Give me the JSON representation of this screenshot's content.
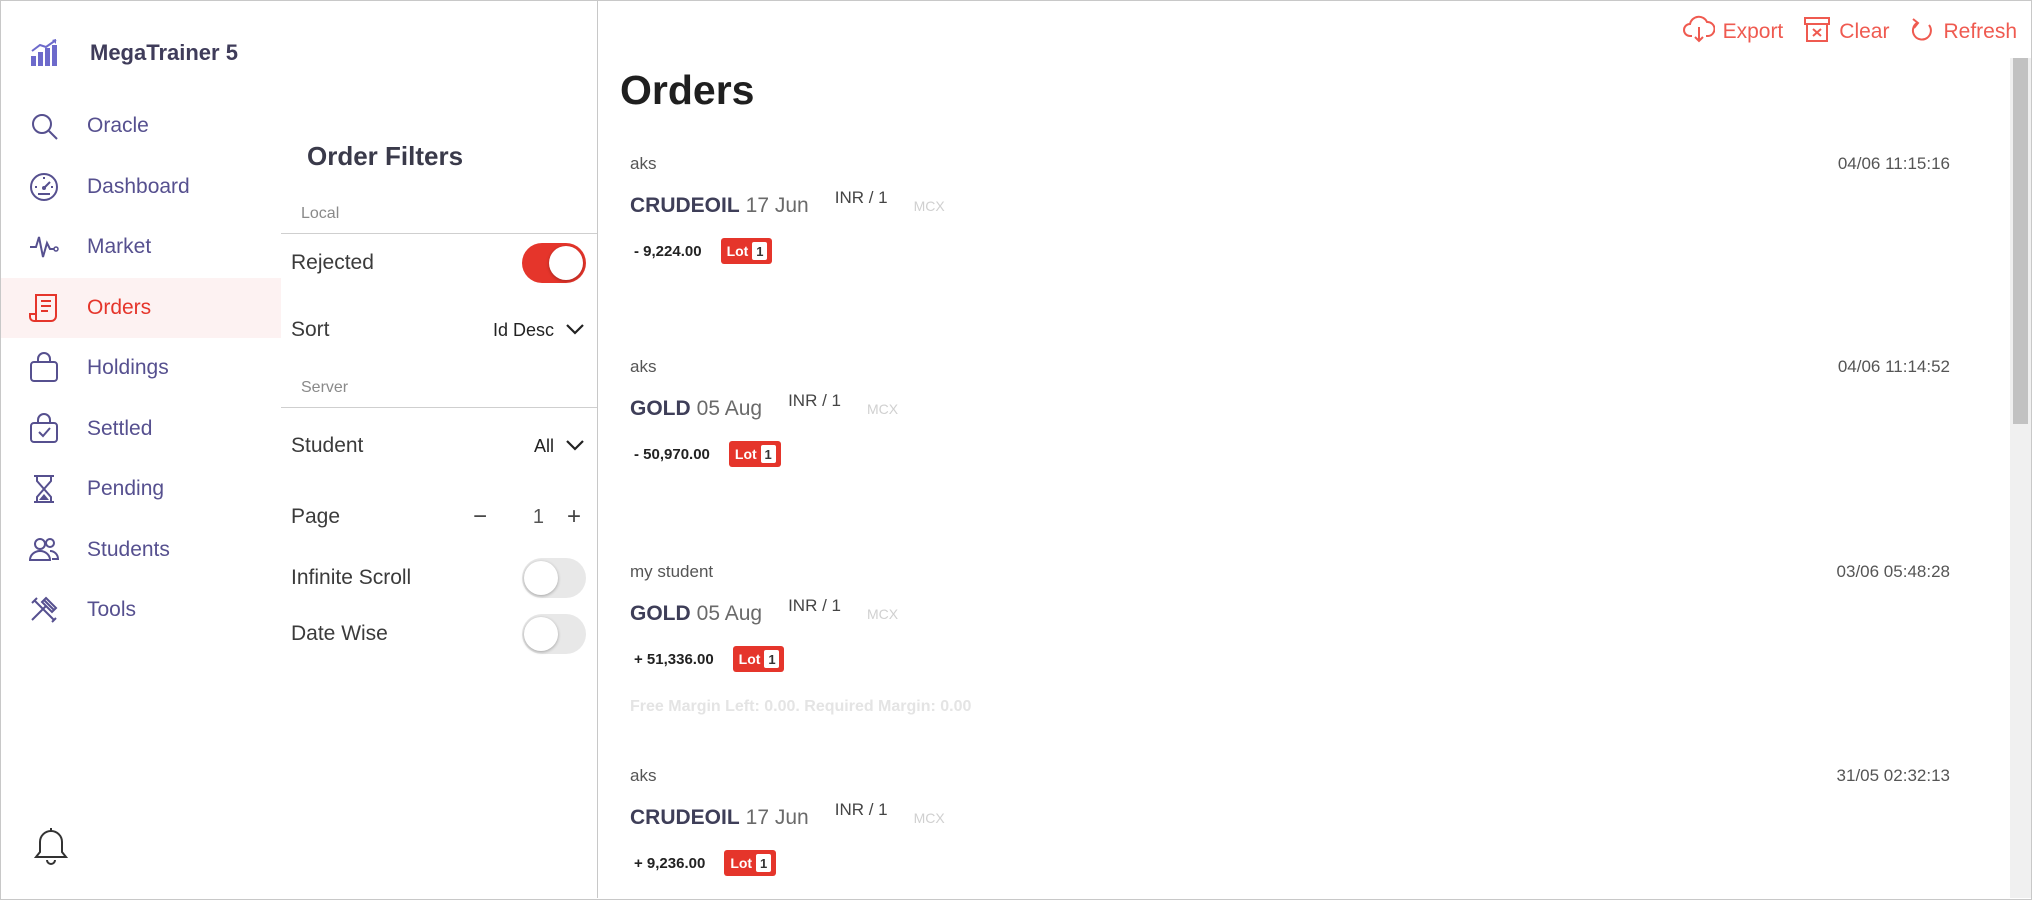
{
  "app": {
    "name": "MegaTrainer 5"
  },
  "nav": {
    "items": [
      {
        "label": "Oracle",
        "icon": "search-icon"
      },
      {
        "label": "Dashboard",
        "icon": "gauge-icon"
      },
      {
        "label": "Market",
        "icon": "pulse-icon"
      },
      {
        "label": "Orders",
        "icon": "receipt-icon",
        "active": true
      },
      {
        "label": "Holdings",
        "icon": "bag-icon"
      },
      {
        "label": "Settled",
        "icon": "bag-check-icon"
      },
      {
        "label": "Pending",
        "icon": "hourglass-icon"
      },
      {
        "label": "Students",
        "icon": "users-icon"
      },
      {
        "label": "Tools",
        "icon": "tools-icon"
      }
    ]
  },
  "filters": {
    "title": "Order Filters",
    "local_label": "Local",
    "rejected_label": "Rejected",
    "rejected_on": true,
    "sort_label": "Sort",
    "sort_value": "Id Desc",
    "server_label": "Server",
    "student_label": "Student",
    "student_value": "All",
    "page_label": "Page",
    "page_value": "1",
    "page_minus": "−",
    "page_plus": "+",
    "infinite_label": "Infinite Scroll",
    "infinite_on": false,
    "datewise_label": "Date Wise",
    "datewise_on": false
  },
  "toolbar": {
    "export": "Export",
    "clear": "Clear",
    "refresh": "Refresh"
  },
  "main": {
    "title": "Orders"
  },
  "orders": [
    {
      "user": "aks",
      "time": "04/06 11:15:16",
      "symbol": "CRUDEOIL",
      "expiry": "17 Jun",
      "currency": "INR / 1",
      "exchange": "MCX",
      "amount": "- 9,224.00",
      "lot_label": "Lot",
      "lot": "1",
      "note": ""
    },
    {
      "user": "aks",
      "time": "04/06 11:14:52",
      "symbol": "GOLD",
      "expiry": "05 Aug",
      "currency": "INR / 1",
      "exchange": "MCX",
      "amount": "- 50,970.00",
      "lot_label": "Lot",
      "lot": "1",
      "note": ""
    },
    {
      "user": "my student",
      "time": "03/06 05:48:28",
      "symbol": "GOLD",
      "expiry": "05 Aug",
      "currency": "INR / 1",
      "exchange": "MCX",
      "amount": "+ 51,336.00",
      "lot_label": "Lot",
      "lot": "1",
      "note": "Free Margin Left: 0.00. Required Margin: 0.00"
    },
    {
      "user": "aks",
      "time": "31/05 02:32:13",
      "symbol": "CRUDEOIL",
      "expiry": "17 Jun",
      "currency": "INR / 1",
      "exchange": "MCX",
      "amount": "+ 9,236.00",
      "lot_label": "Lot",
      "lot": "1",
      "note": ""
    }
  ],
  "colors": {
    "accent": "#e5352b",
    "nav_text": "#56508f",
    "active_bg": "#fdf2f2",
    "tool": "#ef5a50"
  }
}
